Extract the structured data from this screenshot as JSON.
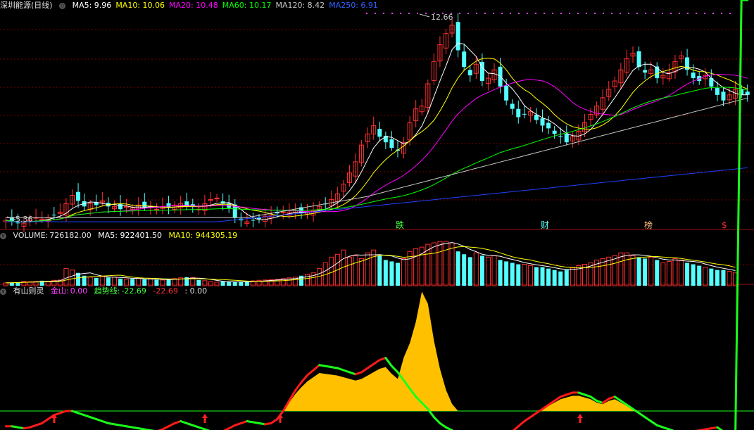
{
  "price_header": {
    "title": "深圳能源(日线)",
    "ma": [
      {
        "label": "MA5:",
        "value": "9.96",
        "color": "#ffffff"
      },
      {
        "label": "MA10:",
        "value": "10.06",
        "color": "#ffff00"
      },
      {
        "label": "MA20:",
        "value": "10.48",
        "color": "#ff00ff"
      },
      {
        "label": "MA60:",
        "value": "10.17",
        "color": "#00ff00"
      },
      {
        "label": "MA120:",
        "value": "8.42",
        "color": "#c8c8c8"
      },
      {
        "label": "MA250:",
        "value": "6.91",
        "color": "#3060ff"
      }
    ]
  },
  "volume_header": {
    "label": "VOLUME:",
    "value": "726182.00",
    "ma5": "MA5: 922401.50",
    "ma10": "MA10: 944305.19"
  },
  "indicator_header": {
    "name": "有山则灵",
    "jinshan_label": "金山:",
    "jinshan_value": "0.00",
    "trend_label": "趋势线:",
    "trend_value": "-22.69",
    "neg_value": "-22.69",
    "extra_value": ": 0.00"
  },
  "annotations": {
    "high_label": "12.66",
    "low_label": "5.36",
    "markers": [
      "跌",
      "财",
      "榜",
      "$"
    ]
  },
  "colors": {
    "up": "#ff3030",
    "down": "#54ffff",
    "ma5": "#ffffff",
    "ma10": "#ffff00",
    "ma20": "#ff00ff",
    "ma60": "#00ff00",
    "ma120": "#c8c8c8",
    "ma250": "#2040ff",
    "mountain": "#ffc000",
    "trend_up": "#ff1a1a",
    "trend_down": "#1aff1a",
    "divider": "#a01010"
  },
  "chart_data": {
    "type": "candlestick",
    "price_range": [
      5.2,
      13.0
    ],
    "high": 12.66,
    "low": 5.36,
    "close_path": [
      5.5,
      5.45,
      5.4,
      5.4,
      5.5,
      5.6,
      5.55,
      5.6,
      5.7,
      5.8,
      6.1,
      6.4,
      6.2,
      6.0,
      6.1,
      6.05,
      6.2,
      6.0,
      6.0,
      5.9,
      6.0,
      5.95,
      6.05,
      5.95,
      6.0,
      5.9,
      6.0,
      5.95,
      6.05,
      6.1,
      6.0,
      6.0,
      5.9,
      6.1,
      6.25,
      6.3,
      6.1,
      5.95,
      5.6,
      5.5,
      5.45,
      5.5,
      5.55,
      5.65,
      5.7,
      5.75,
      5.8,
      5.8,
      5.85,
      5.75,
      5.8,
      5.85,
      6.0,
      6.1,
      6.25,
      6.45,
      6.8,
      7.2,
      7.6,
      8.2,
      8.6,
      8.9,
      8.5,
      8.3,
      8.1,
      8.0,
      8.3,
      9.0,
      9.5,
      9.6,
      10.4,
      11.2,
      11.8,
      12.2,
      12.5,
      11.6,
      11.0,
      10.7,
      11.1,
      10.5,
      10.6,
      10.9,
      10.3,
      9.8,
      9.5,
      9.2,
      9.3,
      9.4,
      9.1,
      8.9,
      8.8,
      8.6,
      8.5,
      8.3,
      8.5,
      8.7,
      9.0,
      9.3,
      9.6,
      9.9,
      10.2,
      10.5,
      10.9,
      11.3,
      11.5,
      11.0,
      10.8,
      10.9,
      10.6,
      10.7,
      10.8,
      11.2,
      11.4,
      10.9,
      10.6,
      10.5,
      10.7,
      10.3,
      10.0,
      9.8,
      10.0,
      10.2,
      10.0,
      10.0
    ],
    "volume": [
      20,
      22,
      25,
      30,
      28,
      30,
      35,
      32,
      38,
      40,
      120,
      110,
      90,
      70,
      60,
      55,
      65,
      58,
      60,
      50,
      45,
      48,
      52,
      44,
      46,
      42,
      40,
      45,
      50,
      55,
      60,
      58,
      40,
      35,
      28,
      25,
      30,
      26,
      25,
      28,
      30,
      34,
      38,
      40,
      42,
      45,
      50,
      55,
      60,
      70,
      80,
      90,
      120,
      160,
      200,
      220,
      250,
      200,
      210,
      190,
      230,
      250,
      210,
      180,
      170,
      160,
      190,
      240,
      260,
      270,
      290,
      300,
      310,
      310,
      300,
      240,
      220,
      200,
      230,
      210,
      200,
      210,
      180,
      170,
      160,
      150,
      150,
      140,
      130,
      130,
      120,
      110,
      100,
      110,
      130,
      140,
      150,
      160,
      180,
      190,
      200,
      210,
      230,
      230,
      210,
      200,
      190,
      200,
      180,
      160,
      170,
      190,
      180,
      160,
      150,
      140,
      130,
      120,
      110,
      110,
      100,
      90
    ],
    "indicator": {
      "jinshan_peak": 100,
      "trend_line": [
        -15,
        -15,
        -16,
        -17,
        -16,
        -14,
        -12,
        -8,
        -4,
        -2,
        0,
        0,
        -2,
        -4,
        -6,
        -8,
        -10,
        -12,
        -13,
        -14,
        -15,
        -16,
        -17,
        -18,
        -19,
        -20,
        -18,
        -15,
        -12,
        -10,
        -12,
        -14,
        -16,
        -18,
        -20,
        -22,
        -20,
        -17,
        -14,
        -12,
        -10,
        -11,
        -12,
        -13,
        -12,
        -8,
        0,
        10,
        20,
        28,
        35,
        40,
        45,
        44,
        43,
        42,
        40,
        38,
        36,
        38,
        42,
        46,
        50,
        52,
        44,
        38,
        30,
        22,
        14,
        8,
        2,
        -6,
        -12,
        -16,
        -19,
        -22,
        -24,
        -25,
        -26,
        -27,
        -28,
        -28,
        -27,
        -24,
        -20,
        -15,
        -10,
        -6,
        -2,
        2,
        6,
        10,
        14,
        16,
        18,
        18,
        16,
        14,
        10,
        8,
        12,
        14,
        10,
        6,
        2,
        -2,
        -6,
        -10,
        -14,
        -16,
        -18,
        -20,
        -22,
        -21,
        -20,
        -19,
        -18,
        -17,
        -16,
        -20,
        -22,
        -22
      ]
    },
    "series": [
      {
        "name": "MA5"
      },
      {
        "name": "MA10"
      },
      {
        "name": "MA20"
      },
      {
        "name": "MA60"
      },
      {
        "name": "MA120"
      },
      {
        "name": "MA250"
      }
    ]
  }
}
